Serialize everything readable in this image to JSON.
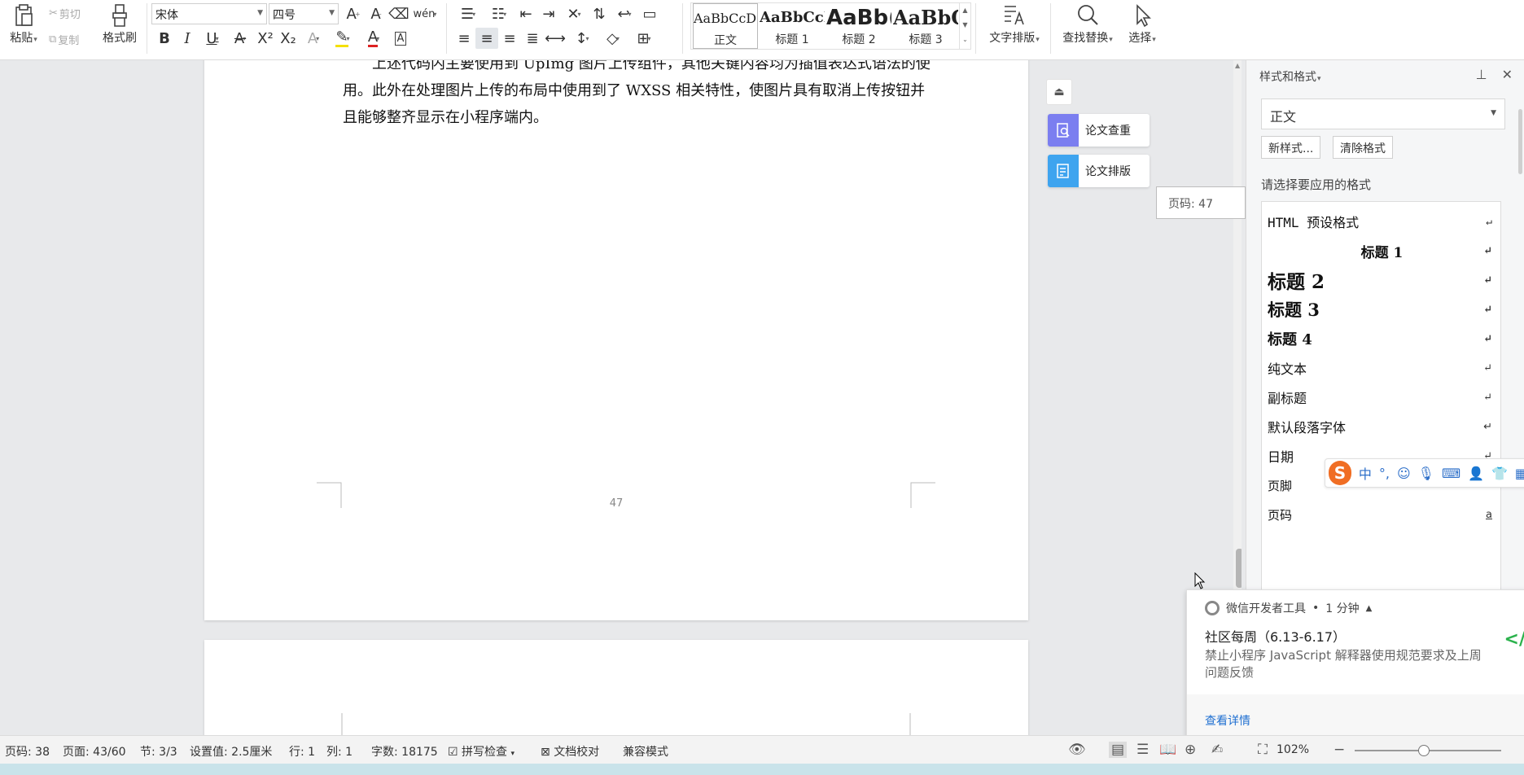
{
  "ribbon": {
    "clipboard": {
      "paste": "粘贴",
      "cut": "剪切",
      "copy": "复制",
      "format_painter": "格式刷"
    },
    "font": {
      "family": "宋体",
      "size": "四号"
    },
    "styles": [
      {
        "preview": "AaBbCcDd",
        "name": "正文"
      },
      {
        "preview": "AaBbCcI",
        "name": "标题 1"
      },
      {
        "preview": "AaBb(",
        "name": "标题 2"
      },
      {
        "preview": "AaBbC",
        "name": "标题 3"
      }
    ],
    "text_layout": "文字排版",
    "find_replace": "查找替换",
    "select": "选择",
    "pinyin_glyph": "wén"
  },
  "document": {
    "para_lines": [
      "上述代码内主要使用到 UpImg 图片上传组件，其他关键内容均为插值表达式语法的使",
      "用。此外在处理图片上传的布局中使用到了 WXSS 相关特性，使图片具有取消上传按钮并",
      "且能够整齐显示在小程序端内。"
    ],
    "page_number": "47"
  },
  "side_tools": {
    "check": "论文查重",
    "format": "论文排版",
    "page_tip": "页码: 47"
  },
  "style_panel": {
    "title": "样式和格式",
    "current": "正文",
    "new_style": "新样式...",
    "clear_format": "清除格式",
    "prompt": "请选择要应用的格式",
    "items": [
      {
        "label": "HTML 预设格式",
        "mark": "↵"
      },
      {
        "label": "标题 1",
        "mark": "↵"
      },
      {
        "label": "标题 2",
        "mark": "↵"
      },
      {
        "label": "标题 3",
        "mark": "↵"
      },
      {
        "label": "标题 4",
        "mark": "↵"
      },
      {
        "label": "纯文本",
        "mark": "↵"
      },
      {
        "label": "副标题",
        "mark": "↵"
      },
      {
        "label": "默认段落字体",
        "mark": "↵"
      },
      {
        "label": "日期",
        "mark": "↵"
      },
      {
        "label": "页脚",
        "mark": "↵"
      },
      {
        "label": "页码",
        "mark": "a"
      }
    ]
  },
  "ime": {
    "lang": "中",
    "punct": "°,"
  },
  "notification": {
    "app": "微信开发者工具",
    "time": "1 分钟",
    "title": "社区每周（6.13-6.17）",
    "body": "禁止小程序 JavaScript 解释器使用规范要求及上周问题反馈",
    "link": "查看详情",
    "badge": "</"
  },
  "status_bar": {
    "page_no": "页码: 38",
    "pages": "页面: 43/60",
    "section": "节: 3/3",
    "setting": "设置值: 2.5厘米",
    "row": "行: 1",
    "col": "列: 1",
    "words": "字数: 18175",
    "spell": "拼写检查",
    "proof": "文档校对",
    "compat": "兼容模式",
    "zoom": "102%"
  },
  "colors": {
    "accent_blue": "#1f6fd1",
    "paper_check_bg": "#7b7ef0",
    "paper_format_bg": "#3ea4ef",
    "ime_orange": "#f06e24",
    "wechat_green": "#2bb24c"
  }
}
